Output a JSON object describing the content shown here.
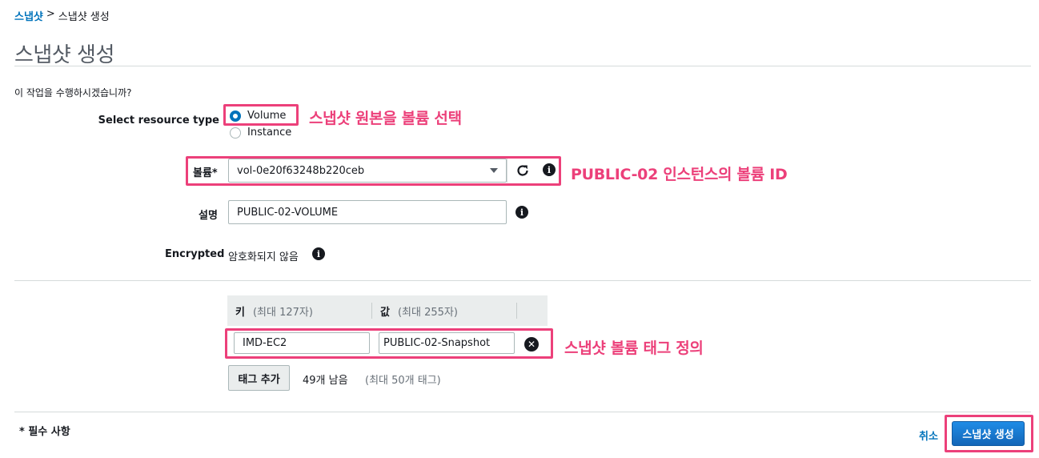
{
  "breadcrumb": {
    "link": "스냅샷",
    "separator": ">",
    "current": "스냅샷 생성"
  },
  "page_title": "스냅샷 생성",
  "question": "이 작업을 수행하시겠습니까?",
  "resource_type": {
    "label": "Select resource type",
    "options": [
      {
        "label": "Volume",
        "selected": true
      },
      {
        "label": "Instance",
        "selected": false
      }
    ]
  },
  "volume": {
    "label": "볼륨*",
    "value": "vol-0e20f63248b220ceb"
  },
  "description": {
    "label": "설명",
    "value": "PUBLIC-02-VOLUME"
  },
  "encrypted": {
    "label": "Encrypted",
    "value": "암호화되지 않음"
  },
  "tags": {
    "key_header": "키",
    "key_hint": "(최대 127자)",
    "value_header": "값",
    "value_hint": "(최대 255자)",
    "rows": [
      {
        "key": "IMD-EC2",
        "value": "PUBLIC-02-Snapshot"
      }
    ],
    "add_button": "태그 추가",
    "remaining": "49개 남음",
    "max_hint": "(최대 50개 태그)"
  },
  "footer": {
    "required_note": "* 필수 사항",
    "cancel": "취소",
    "create": "스냅샷 생성"
  },
  "annotations": {
    "volume_choice": "스냅샷 원본을 볼륨 선택",
    "volume_id": "PUBLIC-02 인스턴스의 볼륨 ID",
    "tag_def": "스냅샷 볼륨 태그 정의"
  },
  "colors": {
    "highlight": "#ec407a",
    "link": "#0073bb",
    "primary_button": "#1a7fd6"
  },
  "icons": [
    "info-icon",
    "refresh-icon",
    "dropdown-caret-icon",
    "remove-tag-icon"
  ]
}
